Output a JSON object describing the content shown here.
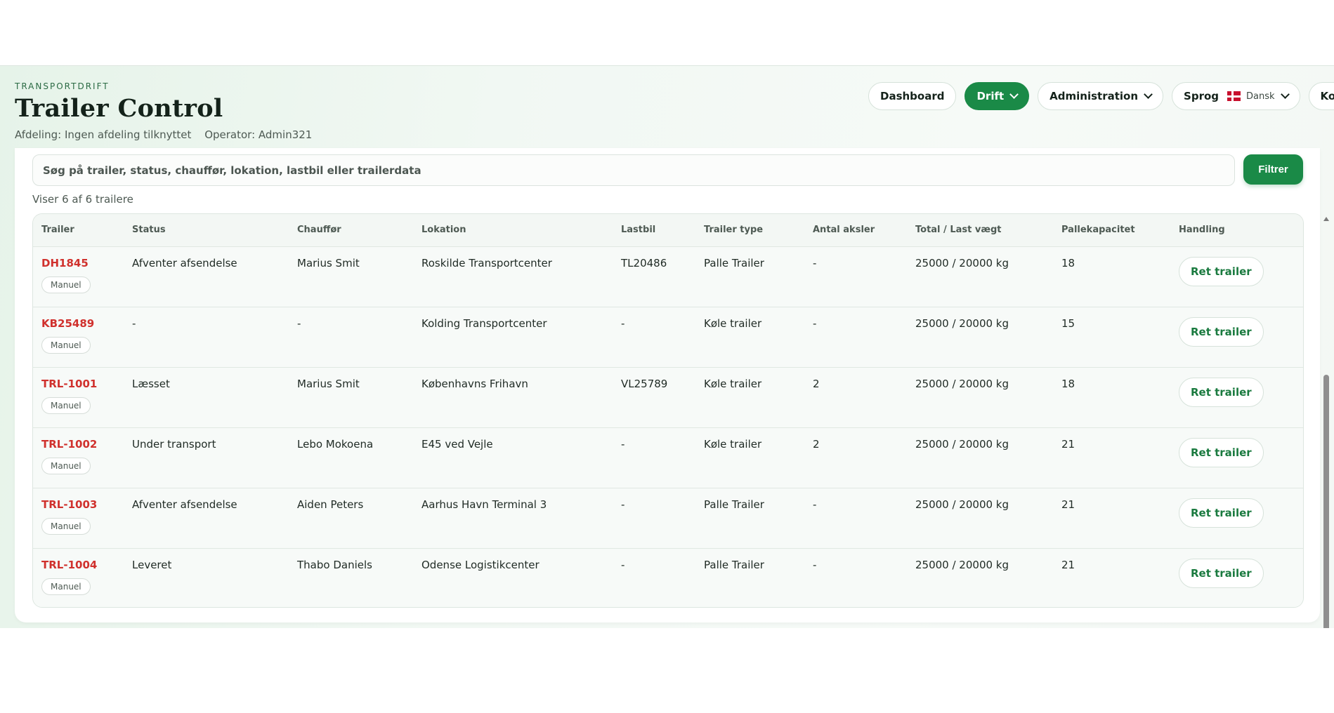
{
  "header": {
    "eyebrow": "TRANSPORTDRIFT",
    "title": "Trailer Control",
    "department": "Afdeling: Ingen afdeling tilknyttet",
    "operator": "Operator: Admin321"
  },
  "nav": {
    "dashboard": "Dashboard",
    "drift": "Drift",
    "administration": "Administration",
    "language_label": "Sprog",
    "language_value": "Dansk",
    "account": "Konto"
  },
  "search": {
    "placeholder": "Søg på trailer, status, chauffør, lokation, lastbil eller trailerdata",
    "filter_label": "Filtrer"
  },
  "count_text": "Viser 6 af 6 trailere",
  "table": {
    "headers": {
      "trailer": "Trailer",
      "status": "Status",
      "driver": "Chauffør",
      "location": "Lokation",
      "truck": "Lastbil",
      "type": "Trailer type",
      "axles": "Antal aksler",
      "weight": "Total / Last vægt",
      "pallets": "Pallekapacitet",
      "action": "Handling"
    },
    "rows": [
      {
        "id": "DH1845",
        "tag": "Manuel",
        "status": "Afventer afsendelse",
        "driver": "Marius Smit",
        "location": "Roskilde Transportcenter",
        "truck": "TL20486",
        "type": "Palle Trailer",
        "axles": "-",
        "weight": "25000 / 20000 kg",
        "pallets": "18",
        "action": "Ret trailer"
      },
      {
        "id": "KB25489",
        "tag": "Manuel",
        "status": "-",
        "driver": "-",
        "location": "Kolding Transportcenter",
        "truck": "-",
        "type": "Køle trailer",
        "axles": "-",
        "weight": "25000 / 20000 kg",
        "pallets": "15",
        "action": "Ret trailer"
      },
      {
        "id": "TRL-1001",
        "tag": "Manuel",
        "status": "Læsset",
        "driver": "Marius Smit",
        "location": "Københavns Frihavn",
        "truck": "VL25789",
        "type": "Køle trailer",
        "axles": "2",
        "weight": "25000 / 20000 kg",
        "pallets": "18",
        "action": "Ret trailer"
      },
      {
        "id": "TRL-1002",
        "tag": "Manuel",
        "status": "Under transport",
        "driver": "Lebo Mokoena",
        "location": "E45 ved Vejle",
        "truck": "-",
        "type": "Køle trailer",
        "axles": "2",
        "weight": "25000 / 20000 kg",
        "pallets": "21",
        "action": "Ret trailer"
      },
      {
        "id": "TRL-1003",
        "tag": "Manuel",
        "status": "Afventer afsendelse",
        "driver": "Aiden Peters",
        "location": "Aarhus Havn Terminal 3",
        "truck": "-",
        "type": "Palle Trailer",
        "axles": "-",
        "weight": "25000 / 20000 kg",
        "pallets": "21",
        "action": "Ret trailer"
      },
      {
        "id": "TRL-1004",
        "tag": "Manuel",
        "status": "Leveret",
        "driver": "Thabo Daniels",
        "location": "Odense Logistikcenter",
        "truck": "-",
        "type": "Palle Trailer",
        "axles": "-",
        "weight": "25000 / 20000 kg",
        "pallets": "21",
        "action": "Ret trailer"
      }
    ]
  },
  "colors": {
    "accent": "#1a8a47",
    "trailer_id": "#d0312d"
  }
}
